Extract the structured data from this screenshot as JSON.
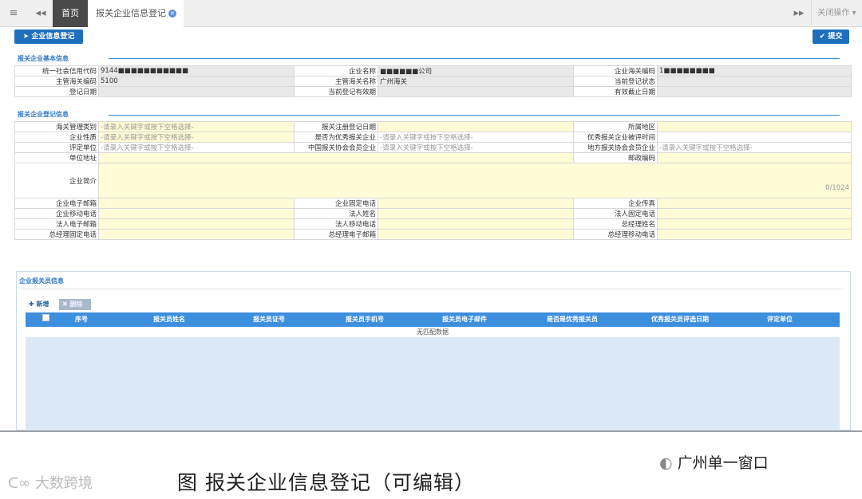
{
  "tabs": {
    "home": "首页",
    "current": "报关企业信息登记",
    "close_ops": "关闭操作"
  },
  "toolbar": {
    "register": "企业信息登记",
    "submit": "提交"
  },
  "basic": {
    "title": "报关企业基本信息",
    "labels": {
      "credit_code": "统一社会信用代码",
      "name": "企业名称",
      "customs_code": "企业海关编码",
      "authority_code": "主管海关编码",
      "authority_name": "主管海关名称",
      "status": "当前登记状态",
      "reg_date": "登记日期",
      "valid_period": "当前登记有效期",
      "expiry": "有效截止日期"
    },
    "values": {
      "credit_code": "9144■■■■■■■■■■■",
      "name": "■■■■■■公司",
      "customs_code": "1■■■■■■■■",
      "authority_code": "5100",
      "authority_name": "广州海关"
    }
  },
  "reg": {
    "title": "报关企业登记信息",
    "placeholder": "-请录入关键字或按下空格选择-",
    "labels": {
      "customs_category": "海关管理类别",
      "reg_date": "报关注册登记日期",
      "region": "所属地区",
      "nature": "企业性质",
      "excellent": "是否为优秀报关企业",
      "eval_time": "优秀报关企业被评时间",
      "rating_unit": "评定单位",
      "china_assoc": "中国报关协会会员企业",
      "local_assoc": "地方报关协会会员企业",
      "address": "单位地址",
      "postal": "邮政编码",
      "intro": "企业简介",
      "email": "企业电子邮箱",
      "fixed_phone": "企业固定电话",
      "fax": "企业传真",
      "mobile": "企业移动电话",
      "legal_name": "法人姓名",
      "legal_phone": "法人固定电话",
      "legal_email": "法人电子邮箱",
      "legal_mobile": "法人移动电话",
      "gm_name": "总经理姓名",
      "gm_phone": "总经理固定电话",
      "gm_email": "总经理电子邮箱",
      "gm_mobile": "总经理移动电话"
    },
    "intro_count": "0/1024"
  },
  "brokers": {
    "title": "企业报关员信息",
    "add": "新增",
    "delete": "删除",
    "columns": [
      "序号",
      "报关员姓名",
      "报关员证号",
      "报关员手机号",
      "报关员电子邮件",
      "是否是优秀报关员",
      "优秀报关员评选日期",
      "评定单位"
    ],
    "empty": "无匹配数据"
  },
  "caption": "图  报关企业信息登记（可编辑）",
  "watermark_left": "大数跨境",
  "watermark_right": "广州单一窗口"
}
